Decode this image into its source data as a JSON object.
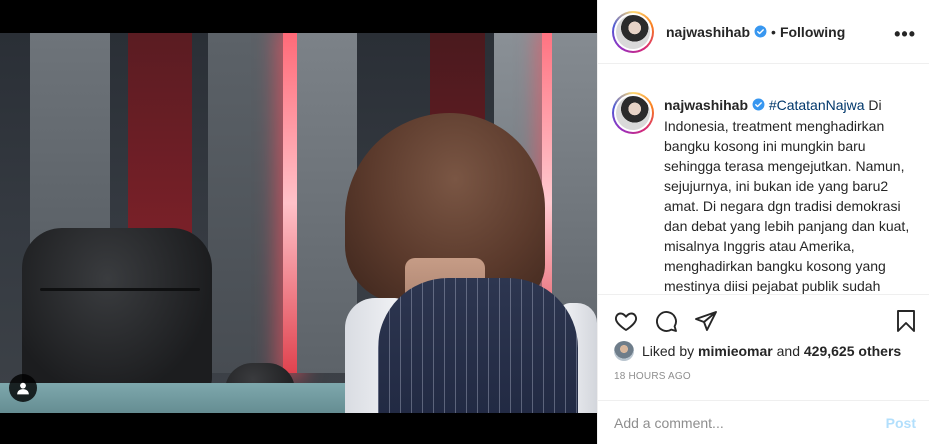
{
  "media": {
    "user_tag_icon": "person-icon"
  },
  "header": {
    "username": "najwashihab",
    "verified_icon": "verified-badge-icon",
    "separator": "•",
    "follow_status": "Following",
    "more_icon": "more-options-icon"
  },
  "caption": {
    "username": "najwashihab",
    "hashtag": "#CatatanNajwa",
    "text": " Di Indonesia, treatment menghadirkan bangku kosong ini mungkin baru sehingga terasa mengejutkan. Namun, sejujurnya, ini bukan ide yang baru2 amat. Di negara dgn tradisi demokrasi dan debat yang lebih panjang dan kuat, misalnya Inggris atau Amerika, menghadirkan bangku kosong yang mestinya diisi pejabat publik sudah biasa."
  },
  "actions": {
    "like_icon": "heart-icon",
    "comment_icon": "comment-icon",
    "share_icon": "share-icon",
    "save_icon": "bookmark-icon"
  },
  "likes": {
    "prefix": "Liked by",
    "user": "mimieomar",
    "conjunction": "and",
    "count": "429,625 others"
  },
  "timestamp": "18 HOURS AGO",
  "comment": {
    "placeholder": "Add a comment...",
    "post_label": "Post"
  },
  "colors": {
    "verified_blue": "#3897f0",
    "post_disabled": "#b2dffc",
    "hashtag": "#00376b"
  }
}
